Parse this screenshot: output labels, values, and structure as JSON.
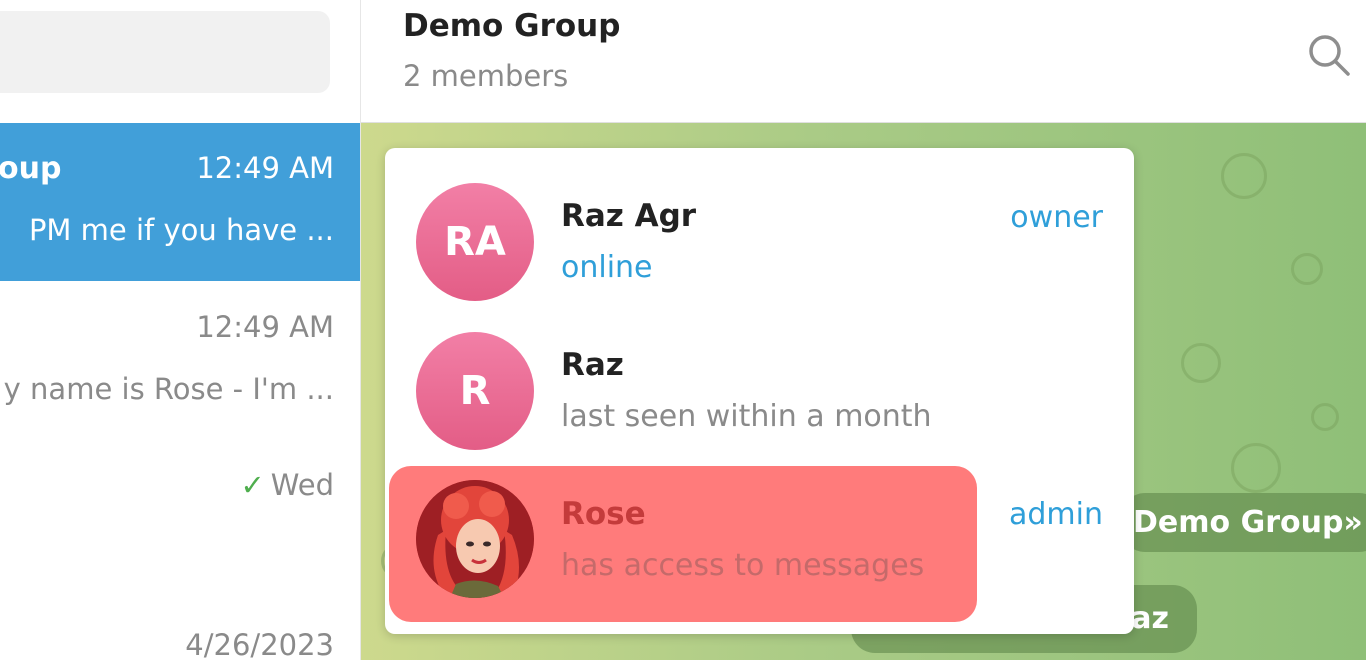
{
  "sidebar": {
    "chats": [
      {
        "name": "oup",
        "time": "12:49 AM",
        "preview": "PM me if you have ..."
      },
      {
        "name": "",
        "time": "12:49 AM",
        "preview": "y name is Rose - I'm ..."
      },
      {
        "name": "",
        "time": "Wed",
        "preview": ""
      },
      {
        "name": "",
        "time": "4/26/2023",
        "preview": ""
      }
    ]
  },
  "header": {
    "title": "Demo Group",
    "subtitle": "2 members"
  },
  "chat": {
    "service_message_1": "Demo Group»",
    "service_message_2": "az"
  },
  "members": [
    {
      "initials": "RA",
      "name": "Raz Agr",
      "status": "online",
      "role": "owner"
    },
    {
      "initials": "R",
      "name": "Raz",
      "status": "last seen within a month",
      "role": ""
    },
    {
      "initials": "",
      "name": "Rose",
      "status": "has access to messages",
      "role": "admin"
    }
  ],
  "colors": {
    "accent": "#419fd9",
    "link": "#2f9fd9",
    "highlight": "#ff7b7b",
    "avatar": "#e35d86"
  }
}
